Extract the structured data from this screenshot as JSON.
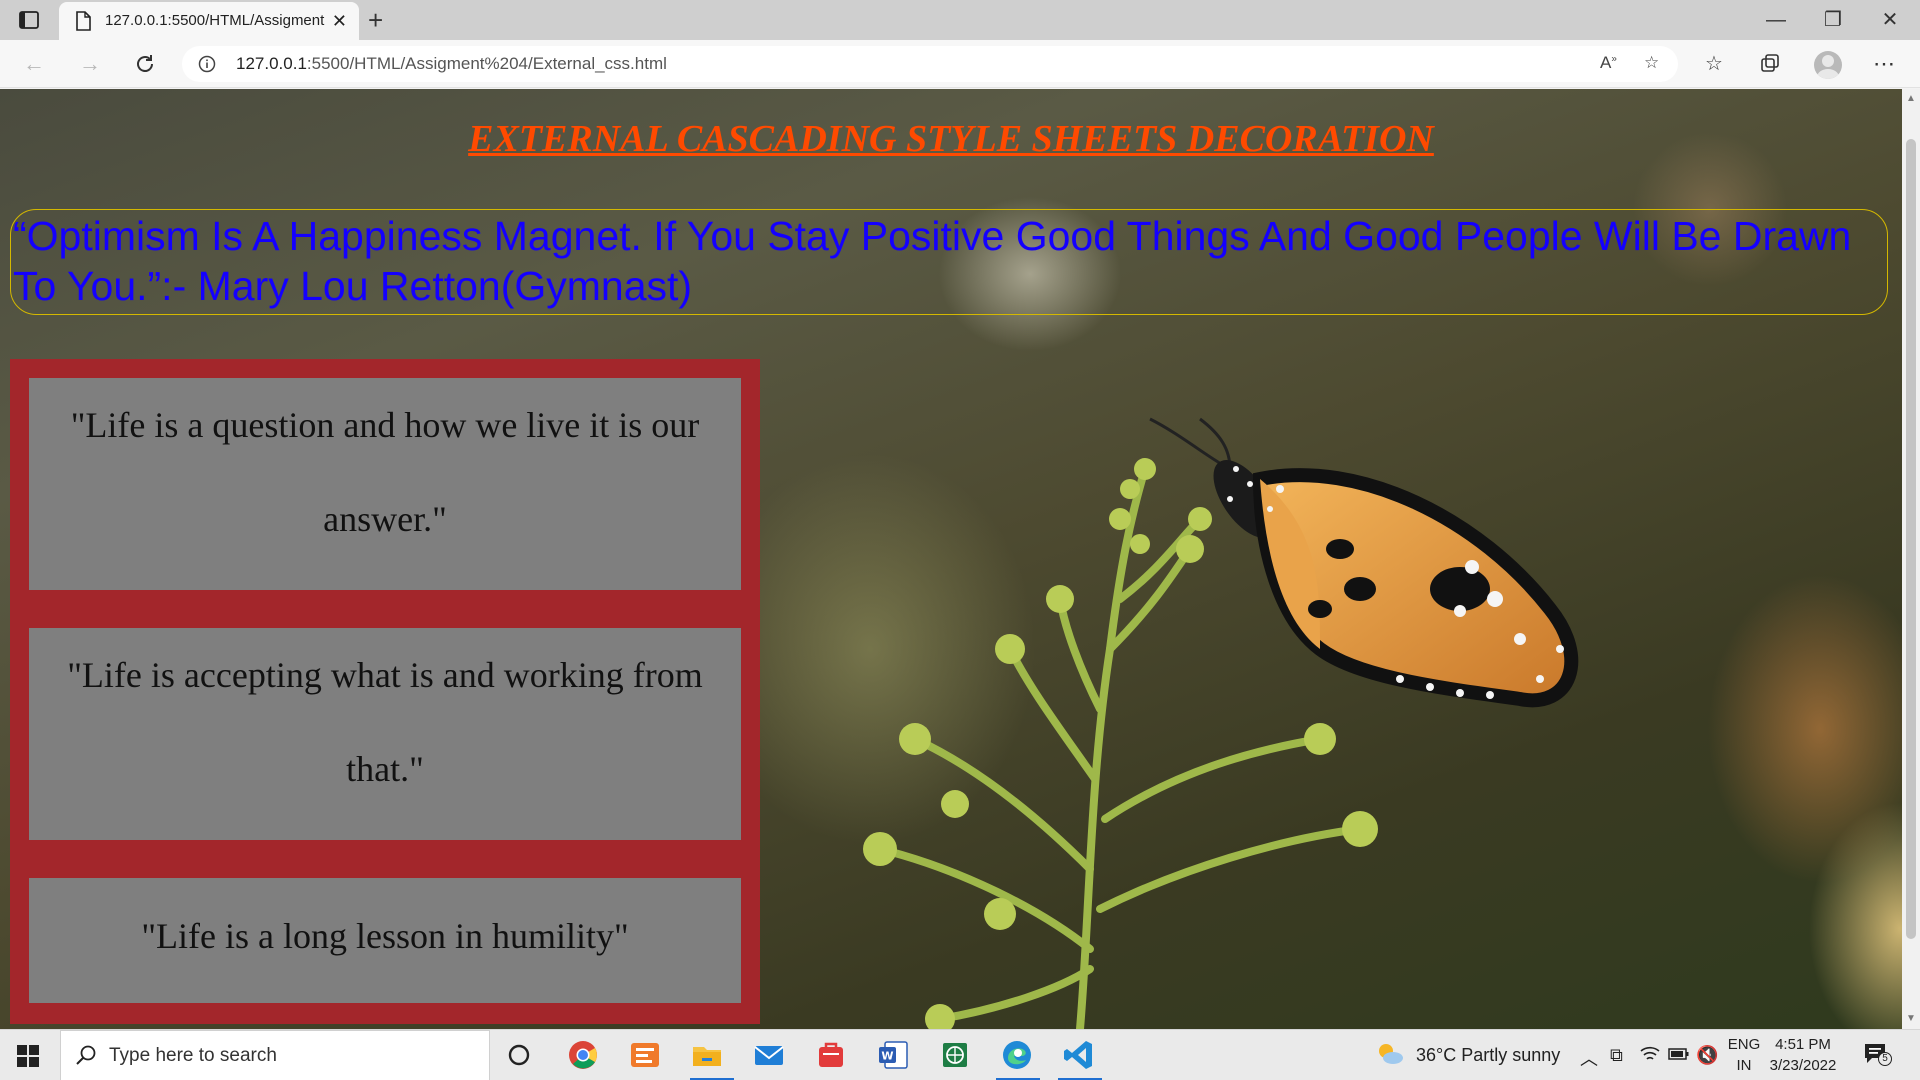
{
  "browser": {
    "tab_title": "127.0.0.1:5500/HTML/Assigment",
    "new_tab": "+",
    "close_tab": "✕",
    "url_host": "127.0.0.1",
    "url_rest": ":5500/HTML/Assigment%204/External_css.html"
  },
  "page": {
    "heading": "EXTERNAL CASCADING STYLE SHEETS DECORATION",
    "quote": "“Optimism Is A Happiness Magnet. If You Stay Positive Good Things And Good People Will Be Drawn To You.”:- Mary Lou Retton(Gymnast)",
    "cards": [
      "\"Life is a question and how we live it is our answer.\"",
      "\"Life is accepting what is and working from that.\"",
      "\"Life is a long lesson in humility\""
    ]
  },
  "taskbar": {
    "search_placeholder": "Type here to search",
    "weather": "36°C  Partly sunny",
    "lang_top": "ENG",
    "lang_bottom": "IN",
    "time": "4:51 PM",
    "date": "3/23/2022",
    "notification_count": "5"
  },
  "colors": {
    "heading": "#ff4a00",
    "quote": "#1400ff",
    "panel": "#a3262b",
    "card": "#7f7f7f"
  }
}
